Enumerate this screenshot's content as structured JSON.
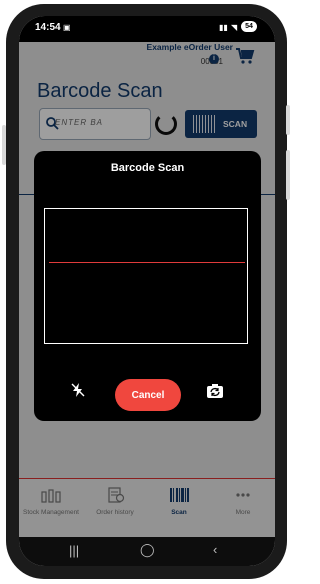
{
  "status_bar": {
    "time": "14:54",
    "battery": "54"
  },
  "header": {
    "user_name": "Example eOrder User",
    "user_id": "00001",
    "info_icon_glyph": "i"
  },
  "page": {
    "title": "Barcode Scan",
    "search_placeholder": "ENTER BA",
    "scan_button_label": "SCAN"
  },
  "modal": {
    "title": "Barcode Scan",
    "cancel_label": "Cancel"
  },
  "bottom_nav": {
    "items": [
      {
        "label": "Stock Management",
        "icon": "bottles-icon"
      },
      {
        "label": "Order history",
        "icon": "order-history-icon"
      },
      {
        "label": "Scan",
        "icon": "barcode-icon",
        "active": true
      },
      {
        "label": "More",
        "icon": "more-dots-icon"
      }
    ]
  },
  "colors": {
    "brand_navy": "#123b6d",
    "cancel_red": "#f0473e",
    "scan_line_red": "#e03b3b"
  }
}
